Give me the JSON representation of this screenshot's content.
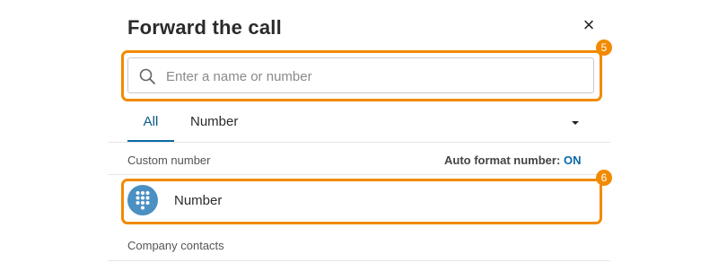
{
  "dialog": {
    "title": "Forward the call",
    "close_symbol": "×"
  },
  "search": {
    "placeholder": "Enter a name or number",
    "value": ""
  },
  "tabs": [
    {
      "label": "All",
      "selected": true
    },
    {
      "label": "Number",
      "selected": false
    }
  ],
  "custom_number": {
    "section_label": "Custom number",
    "auto_format_label": "Auto format number:",
    "auto_format_value": "ON",
    "row_label": "Number"
  },
  "company_contacts": {
    "section_label": "Company contacts"
  },
  "annotations": [
    {
      "number": "5"
    },
    {
      "number": "6"
    }
  ],
  "colors": {
    "accent": "#0b6aa8",
    "highlight": "#f28a00",
    "dialpad": "#4a90c2"
  },
  "icons": {
    "search": "search-icon",
    "close": "close-icon",
    "caret": "caret-down-icon",
    "dialpad": "dialpad-icon"
  }
}
